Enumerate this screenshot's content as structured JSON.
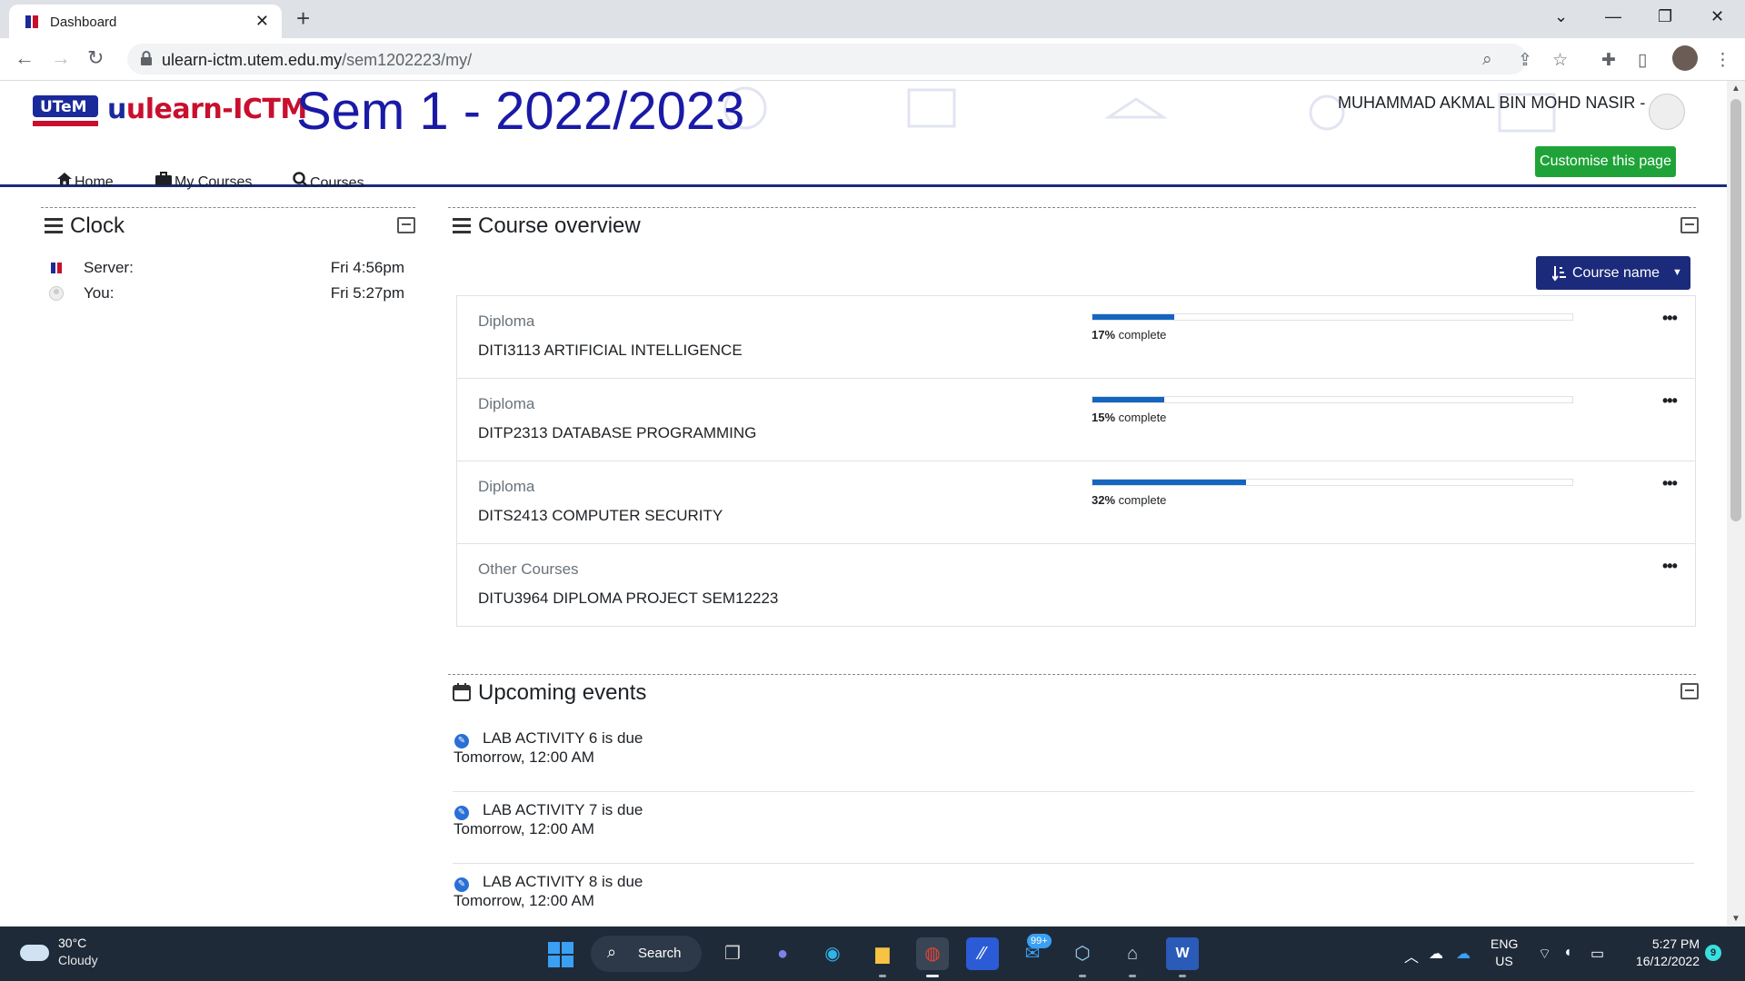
{
  "browser": {
    "tab_title": "Dashboard",
    "url_host": "ulearn-ictm.utem.edu.my",
    "url_path": "/sem1202223/my/"
  },
  "header": {
    "logo_text": "ulearn-ICTM",
    "logo_u": "u",
    "utem_logo_text": "UTeM",
    "sem_title": "Sem 1 - 2022/2023",
    "user_name": "MUHAMMAD AKMAL BIN MOHD NASIR -",
    "brand_color": "#1a1aa6",
    "accent_red": "#c8102e"
  },
  "nav": {
    "home": "Home",
    "my_courses": "My Courses",
    "courses": "Courses",
    "customise": "Customise this page"
  },
  "clock_block": {
    "title": "Clock",
    "rows": [
      {
        "label": "Server:",
        "value": "Fri 4:56pm"
      },
      {
        "label": "You:",
        "value": "Fri 5:27pm"
      }
    ]
  },
  "course_overview": {
    "title": "Course overview",
    "sort_label": "Course name",
    "courses": [
      {
        "category": "Diploma",
        "name": "DITI3113 ARTIFICIAL INTELLIGENCE",
        "progress": 17,
        "pct_num": "17%",
        "pct_text": "complete"
      },
      {
        "category": "Diploma",
        "name": "DITP2313 DATABASE PROGRAMMING",
        "progress": 15,
        "pct_num": "15%",
        "pct_text": "complete"
      },
      {
        "category": "Diploma",
        "name": "DITS2413 COMPUTER SECURITY",
        "progress": 32,
        "pct_num": "32%",
        "pct_text": "complete"
      },
      {
        "category": "Other Courses",
        "name": "DITU3964 DIPLOMA PROJECT SEM12223",
        "progress": null,
        "pct_num": "",
        "pct_text": ""
      }
    ],
    "progress_color": "#1565c0"
  },
  "upcoming_events": {
    "title": "Upcoming events",
    "events": [
      {
        "name": "LAB ACTIVITY 6 is due",
        "day": "Tomorrow",
        "time": ", 12:00 AM"
      },
      {
        "name": "LAB ACTIVITY 7 is due",
        "day": "Tomorrow",
        "time": ", 12:00 AM"
      },
      {
        "name": "LAB ACTIVITY 8 is due",
        "day": "Tomorrow",
        "time": ", 12:00 AM"
      }
    ]
  },
  "taskbar": {
    "weather_temp": "30°C",
    "weather_cond": "Cloudy",
    "search_label": "Search",
    "mail_badge": "99+",
    "lang_1": "ENG",
    "lang_2": "US",
    "time": "5:27 PM",
    "date": "16/12/2022",
    "notification_count": "9"
  },
  "icons": [
    "home-icon",
    "briefcase-icon",
    "search-icon",
    "menu-icon",
    "collapse-icon",
    "calendar-icon",
    "sort-icon",
    "more-icon",
    "event-icon"
  ]
}
